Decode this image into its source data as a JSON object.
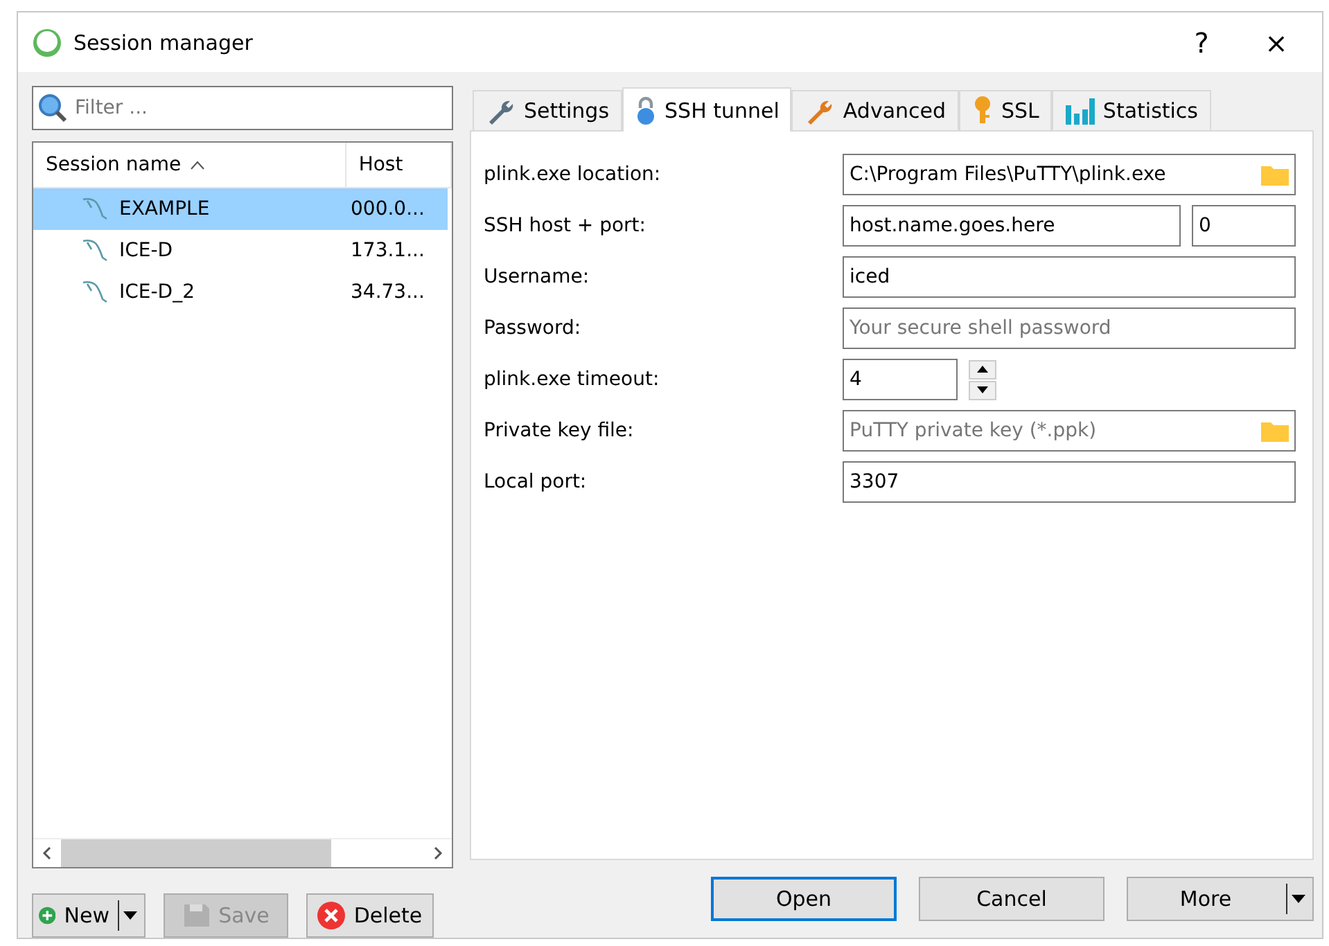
{
  "window": {
    "title": "Session manager",
    "help": "?",
    "close": "×"
  },
  "filter": {
    "placeholder": "Filter ..."
  },
  "sessions": {
    "columns": [
      {
        "label": "Session name",
        "sorted": true
      },
      {
        "label": "Host",
        "sorted": false
      }
    ],
    "rows": [
      {
        "name": "EXAMPLE",
        "host": "000.0...",
        "selected": true
      },
      {
        "name": "ICE-D",
        "host": "173.1...",
        "selected": false
      },
      {
        "name": "ICE-D_2",
        "host": "34.73...",
        "selected": false
      }
    ]
  },
  "left_buttons": [
    {
      "label": "New",
      "kind": "new",
      "disabled": false
    },
    {
      "label": "Save",
      "kind": "save",
      "disabled": true
    },
    {
      "label": "Delete",
      "kind": "delete",
      "disabled": false
    }
  ],
  "tabs": [
    {
      "label": "Settings",
      "kind": "settings",
      "selected": false
    },
    {
      "label": "SSH tunnel",
      "kind": "lock",
      "selected": true
    },
    {
      "label": "Advanced",
      "kind": "advanced",
      "selected": false
    },
    {
      "label": "SSL",
      "kind": "key",
      "selected": false
    },
    {
      "label": "Statistics",
      "kind": "stats",
      "selected": false
    }
  ],
  "form": [
    {
      "label": "plink.exe location:",
      "kind": "file",
      "value": "C:\\Program Files\\PuTTY\\plink.exe"
    },
    {
      "label": "SSH host + port:",
      "kind": "hostport",
      "value": "host.name.goes.here",
      "port": "0"
    },
    {
      "label": "Username:",
      "kind": "text",
      "value": "iced"
    },
    {
      "label": "Password:",
      "kind": "text",
      "placeholder": "Your secure shell password"
    },
    {
      "label": "plink.exe timeout:",
      "kind": "spin",
      "value": "4"
    },
    {
      "label": "Private key file:",
      "kind": "file",
      "placeholder": "PuTTY private key (*.ppk)"
    },
    {
      "label": "Local port:",
      "kind": "text",
      "value": "3307"
    }
  ],
  "buttons": [
    {
      "label": "Open",
      "kind": "default"
    },
    {
      "label": "Cancel",
      "kind": "plain"
    },
    {
      "label": "More",
      "kind": "menu"
    }
  ]
}
